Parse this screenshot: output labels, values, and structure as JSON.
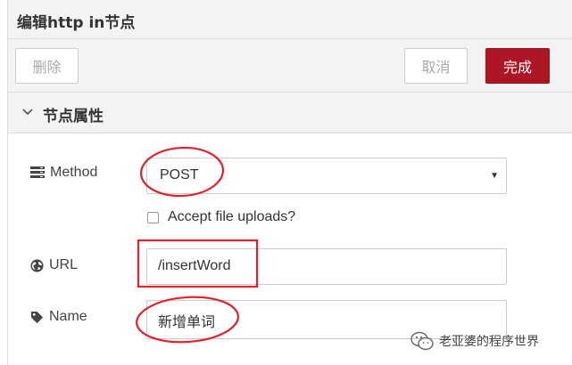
{
  "window": {
    "title": "编辑http in节点"
  },
  "toolbar": {
    "delete_label": "删除",
    "cancel_label": "取消",
    "done_label": "完成",
    "accent": "#ad1625"
  },
  "section": {
    "title": "节点属性"
  },
  "form": {
    "method": {
      "label": "Method",
      "value": "POST",
      "icon": "list-icon"
    },
    "accept_uploads": {
      "label": "Accept file uploads?",
      "checked": false
    },
    "url": {
      "label": "URL",
      "value": "/insertWord",
      "icon": "globe-icon"
    },
    "name": {
      "label": "Name",
      "value": "新增单词",
      "icon": "tag-icon"
    }
  },
  "annotations": {
    "color": "#e0202a"
  },
  "watermark": {
    "text": "老亚婆的程序世界",
    "icon": "wechat-icon"
  }
}
